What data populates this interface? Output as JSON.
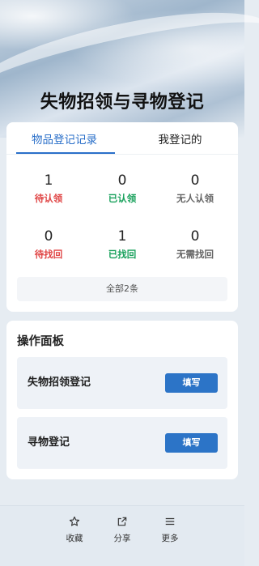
{
  "page": {
    "title": "失物招领与寻物登记"
  },
  "tabs": [
    {
      "label": "物品登记记录",
      "active": true
    },
    {
      "label": "我登记的",
      "active": false
    }
  ],
  "stats": [
    {
      "value": "1",
      "label": "待认领",
      "color": "#e04646"
    },
    {
      "value": "0",
      "label": "已认领",
      "color": "#19a15c"
    },
    {
      "value": "0",
      "label": "无人认领",
      "color": "#666666"
    },
    {
      "value": "0",
      "label": "待找回",
      "color": "#e04646"
    },
    {
      "value": "1",
      "label": "已找回",
      "color": "#19a15c"
    },
    {
      "value": "0",
      "label": "无需找回",
      "color": "#666666"
    }
  ],
  "summary": {
    "total_text": "全部2条"
  },
  "panel": {
    "title": "操作面板",
    "items": [
      {
        "name": "失物招领登记",
        "button": "填写"
      },
      {
        "name": "寻物登记",
        "button": "填写"
      }
    ]
  },
  "footer": {
    "items": [
      {
        "label": "收藏",
        "icon": "star-icon"
      },
      {
        "label": "分享",
        "icon": "share-icon"
      },
      {
        "label": "更多",
        "icon": "menu-icon"
      }
    ]
  },
  "colors": {
    "accent": "#2a6fc9",
    "button": "#2c74c7"
  }
}
